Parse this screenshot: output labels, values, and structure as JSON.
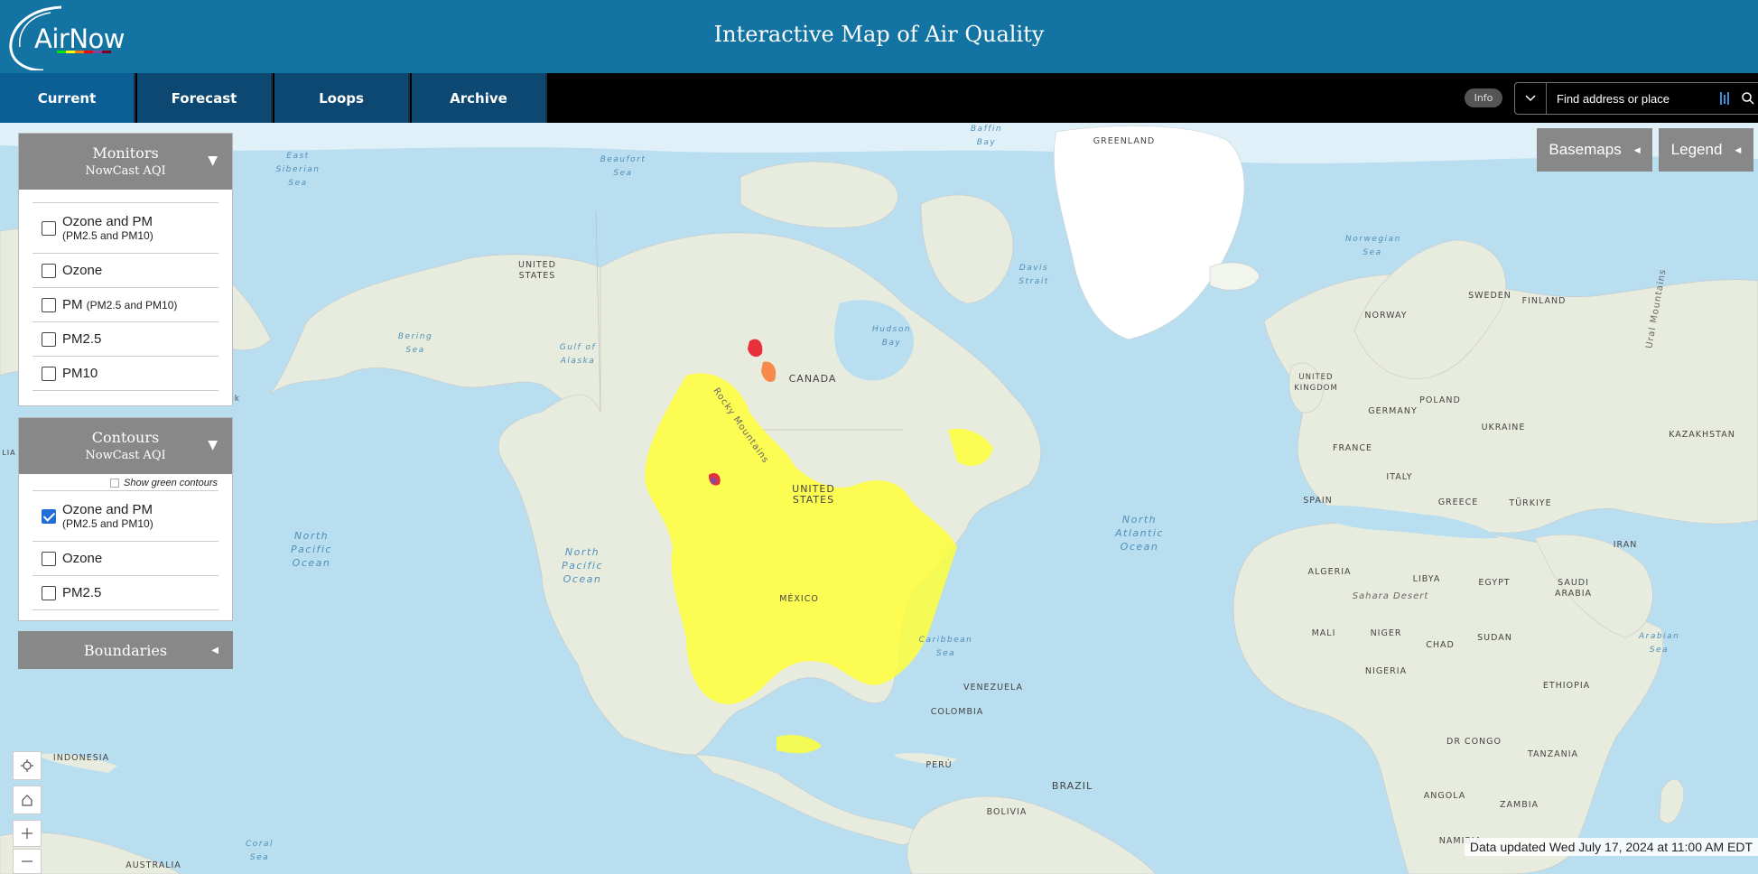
{
  "header": {
    "logo_text": "AirNow",
    "title": "Interactive Map of Air Quality"
  },
  "nav": {
    "tabs": [
      {
        "label": "Current",
        "active": true
      },
      {
        "label": "Forecast",
        "active": false
      },
      {
        "label": "Loops",
        "active": false
      },
      {
        "label": "Archive",
        "active": false
      }
    ],
    "info_label": "Info",
    "search_placeholder": "Find address or place"
  },
  "monitors": {
    "title": "Monitors",
    "subtitle": "NowCast AQI",
    "options": [
      {
        "label": "Ozone and PM",
        "sub": "(PM2.5 and PM10)",
        "checked": false
      },
      {
        "label": "Ozone",
        "sub": "",
        "checked": false
      },
      {
        "label": "PM",
        "sub": "(PM2.5 and PM10)",
        "checked": false
      },
      {
        "label": "PM2.5",
        "sub": "",
        "checked": false
      },
      {
        "label": "PM10",
        "sub": "",
        "checked": false
      }
    ]
  },
  "contours": {
    "title": "Contours",
    "subtitle": "NowCast AQI",
    "green_toggle": "Show green contours",
    "options": [
      {
        "label": "Ozone and PM",
        "sub": "(PM2.5 and PM10)",
        "checked": true
      },
      {
        "label": "Ozone",
        "sub": "",
        "checked": false
      },
      {
        "label": "PM2.5",
        "sub": "",
        "checked": false
      }
    ]
  },
  "boundaries": {
    "title": "Boundaries"
  },
  "map_buttons": {
    "basemaps": "Basemaps",
    "legend": "Legend"
  },
  "map_labels": {
    "east_siberian_sea": "East Siberian Sea",
    "beaufort_sea": "Beaufort Sea",
    "baffin_bay": "Baffin Bay",
    "greenland": "GREENLAND",
    "united_states_ak": "UNITED STATES",
    "davis_strait": "Davis Strait",
    "norwegian_sea": "Norwegian Sea",
    "bering_sea": "Bering Sea",
    "gulf_of_alaska": "Gulf of Alaska",
    "hudson_bay": "Hudson Bay",
    "canada": "CANADA",
    "rocky_mountains": "Rocky Mountains",
    "ural_mountains": "Ural Mountains",
    "sweden": "SWEDEN",
    "finland": "FINLAND",
    "norway": "NORWAY",
    "united_kingdom": "UNITED KINGDOM",
    "poland": "POLAND",
    "germany": "GERMANY",
    "ukraine": "UKRAINE",
    "kazakhstan": "KAZAKHSTAN",
    "france": "FRANCE",
    "italy": "ITALY",
    "spain": "SPAIN",
    "greece": "GREECE",
    "turkiye": "TÜRKIYE",
    "iran": "IRAN",
    "united_states": "UNITED STATES",
    "north_pacific_ocean": "North Pacific Ocean",
    "north_pacific_ocean_2": "North Pacific Ocean",
    "north_atlantic_ocean": "North Atlantic Ocean",
    "algeria": "ALGERIA",
    "libya": "LIBYA",
    "egypt": "EGYPT",
    "saudi_arabia": "SAUDI ARABIA",
    "sahara": "Sahara Desert",
    "arabian_sea": "Arabian Sea",
    "mexico": "MÉXICO",
    "mali": "MALI",
    "niger": "NIGER",
    "chad": "CHAD",
    "sudan": "SUDAN",
    "nigeria": "NIGERIA",
    "ethiopia": "ETHIOPIA",
    "caribbean_sea": "Caribbean Sea",
    "venezuela": "VENEZUELA",
    "colombia": "COLOMBIA",
    "dr_congo": "DR CONGO",
    "tanzania": "TANZANIA",
    "indonesia": "INDONESIA",
    "peru": "PERÚ",
    "brazil": "BRAZIL",
    "angola": "ANGOLA",
    "zambia": "ZAMBIA",
    "bolivia": "BOLIVIA",
    "coral_sea": "Coral Sea",
    "namibia": "NAMIBIA",
    "australia": "AUSTRALIA",
    "lia": "LIA",
    "sk": "sk"
  },
  "status": {
    "updated": "Data updated Wed July 17, 2024 at 11:00 AM EDT"
  },
  "colors": {
    "header": "#1373a3",
    "nav_tab": "#0d4872",
    "ocean": "#b8def0",
    "land": "#e8ecdf",
    "aqi_moderate": "#ffff3a",
    "aqi_usg": "#f7894a",
    "aqi_unhealthy": "#e8303c",
    "aqi_very_unhealthy": "#8b4b9c"
  }
}
